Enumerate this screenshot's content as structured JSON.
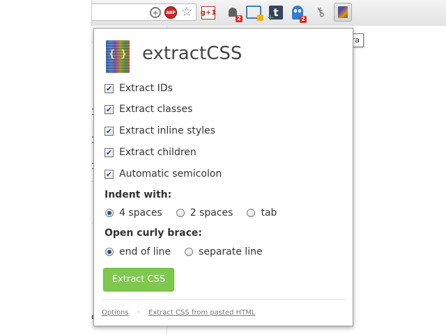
{
  "browser": {
    "tooltip": "Extra",
    "badges": {
      "notifications": "2",
      "ghost": "2"
    },
    "icons": [
      "zoom-icon",
      "adblock-icon",
      "bookmark-star-icon",
      "google-plus-icon",
      "notifications-bell-icon",
      "screenshot-icon",
      "tumblr-icon",
      "ghost-icon",
      "key-icon",
      "extractcss-extension-icon"
    ],
    "abp_text": "ABP",
    "gplus_text": "g+1",
    "tumblr_text": "t"
  },
  "background": {
    "row_numbers": [
      "1",
      "1",
      "1"
    ],
    "partial_text": "e"
  },
  "popup": {
    "title": "extractCSS",
    "logo_text": "{ }",
    "options": [
      {
        "label": "Extract IDs",
        "checked": true
      },
      {
        "label": "Extract classes",
        "checked": true
      },
      {
        "label": "Extract inline styles",
        "checked": true
      },
      {
        "label": "Extract children",
        "checked": true
      },
      {
        "label": "Automatic semicolon",
        "checked": true
      }
    ],
    "indent": {
      "label": "Indent with:",
      "options": [
        {
          "label": "4 spaces",
          "selected": true
        },
        {
          "label": "2 spaces",
          "selected": false
        },
        {
          "label": "tab",
          "selected": false
        }
      ]
    },
    "brace": {
      "label": "Open curly brace:",
      "options": [
        {
          "label": "end of line",
          "selected": true
        },
        {
          "label": "separate line",
          "selected": false
        }
      ]
    },
    "extract_button": "Extract CSS",
    "footer": {
      "options_link": "Options",
      "separator": "·",
      "paste_link": "Extract CSS from pasted HTML"
    }
  },
  "colors": {
    "accent_button": "#7ec850",
    "title_text": "#444444",
    "badge": "#d32f2f"
  }
}
